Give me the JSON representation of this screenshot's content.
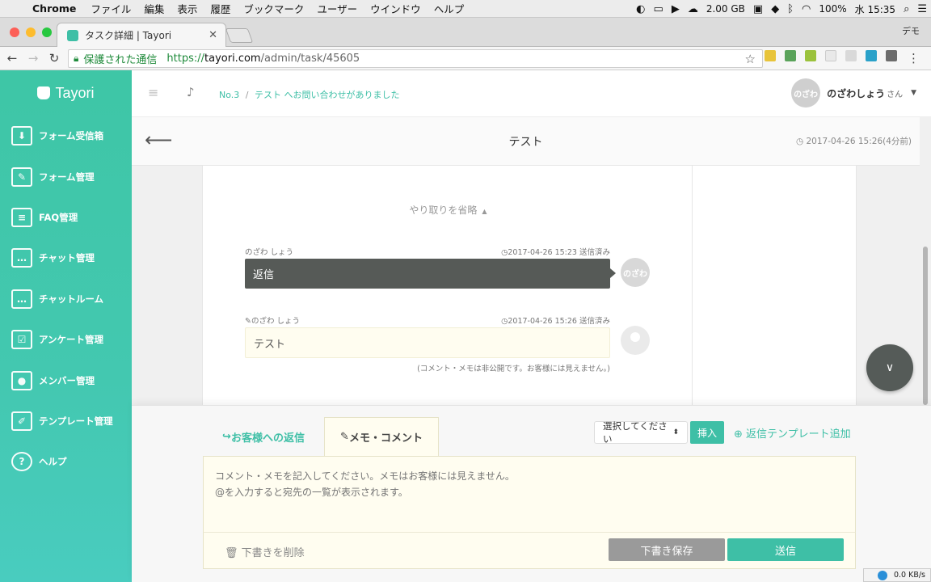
{
  "os_menu": {
    "app_name": "Chrome",
    "items": [
      "ファイル",
      "編集",
      "表示",
      "履歴",
      "ブックマーク",
      "ユーザー",
      "ウインドウ",
      "ヘルプ"
    ],
    "status": {
      "memory": "2.00 GB",
      "battery": "100%",
      "clock": "水 15:35"
    }
  },
  "browser": {
    "tab_title": "タスク詳細 | Tayori",
    "profile": "デモ",
    "secure_label": "保護された通信",
    "url_scheme": "https://",
    "url_host": "tayori.com",
    "url_path": "/admin/task/45605"
  },
  "sidebar": {
    "brand": "Tayori",
    "items": [
      {
        "label": "フォーム受信箱",
        "icon": "inbox-icon"
      },
      {
        "label": "フォーム管理",
        "icon": "edit-form-icon"
      },
      {
        "label": "FAQ管理",
        "icon": "faq-list-icon"
      },
      {
        "label": "チャット管理",
        "icon": "chat-icon"
      },
      {
        "label": "チャットルーム",
        "icon": "chat-room-icon"
      },
      {
        "label": "アンケート管理",
        "icon": "survey-icon"
      },
      {
        "label": "メンバー管理",
        "icon": "members-icon"
      },
      {
        "label": "テンプレート管理",
        "icon": "template-icon"
      },
      {
        "label": "ヘルプ",
        "icon": "help-icon"
      }
    ]
  },
  "header": {
    "breadcrumb_no": "No.3",
    "breadcrumb_sep": "/",
    "breadcrumb_text": "テスト へお問い合わせがありました",
    "user_avatar": "のざわ",
    "user_name": "のざわしょう",
    "user_suffix": "さん"
  },
  "task": {
    "title": "テスト",
    "timestamp": "2017-04-26 15:26(4分前)"
  },
  "thread": {
    "collapse_label": "やり取りを省略",
    "messages": [
      {
        "author": "のざわ しょう",
        "time": "2017-04-26 15:23 送信済み",
        "body": "返信",
        "avatar": "のざわ"
      },
      {
        "author": "のざわ しょう",
        "time": "2017-04-26 15:26 送信済み",
        "body": "テスト"
      }
    ],
    "memo_note": "(コメント・メモは非公開です。お客様には見えません。)"
  },
  "reply": {
    "tab_reply": "お客様への返信",
    "tab_memo": "メモ・コメント",
    "select_value": "選択してください",
    "insert_label": "挿入",
    "add_template": "返信テンプレート追加",
    "placeholder": "コメント・メモを記入してください。メモはお客様には見えません。\n@を入力すると宛先の一覧が表示されます。",
    "delete_draft": "下書きを削除",
    "save_draft": "下書き保存",
    "send": "送信"
  },
  "netspeed": "0.0 KB/s",
  "colors": {
    "accent": "#3ebfa6",
    "dark_bubble": "#565a57",
    "memo_bg": "#fffdf0"
  }
}
